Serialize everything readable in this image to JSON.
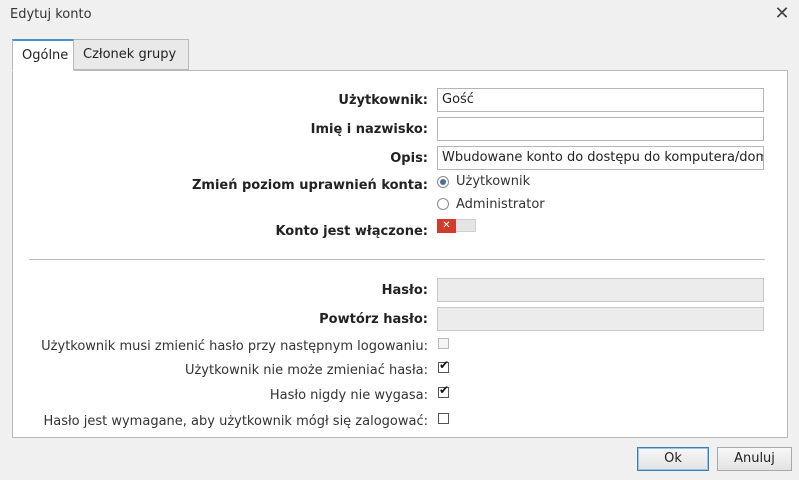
{
  "window": {
    "title": "Edytuj konto",
    "close_icon": "close-icon"
  },
  "tabs": [
    {
      "label": "Ogólne"
    },
    {
      "label": "Członek grupy"
    }
  ],
  "form": {
    "user_label": "Użytkownik:",
    "user_value": "Gość",
    "fullname_label": "Imię i nazwisko:",
    "fullname_value": "",
    "desc_label": "Opis:",
    "desc_value": "Wbudowane konto do dostępu do komputera/domeny",
    "level_label": "Zmień poziom uprawnień konta:",
    "level_options": [
      {
        "label": "Użytkownik",
        "checked": true
      },
      {
        "label": "Administrator",
        "checked": false
      }
    ],
    "enabled_label": "Konto jest włączone:",
    "enabled_value": false,
    "password_label": "Hasło:",
    "password_repeat_label": "Powtórz hasło:",
    "checkboxes": [
      {
        "label": "Użytkownik musi zmienić hasło przy następnym logowaniu:",
        "checked": false,
        "disabled": true
      },
      {
        "label": "Użytkownik nie może zmieniać hasła:",
        "checked": true,
        "disabled": false
      },
      {
        "label": "Hasło nigdy nie wygasa:",
        "checked": true,
        "disabled": false
      },
      {
        "label": "Hasło jest wymagane, aby użytkownik mógł się zalogować:",
        "checked": false,
        "disabled": false
      }
    ]
  },
  "buttons": {
    "ok": "Ok",
    "cancel": "Anuluj"
  },
  "colors": {
    "accent": "#4a90c9",
    "toggle_off": "#d23a2b"
  }
}
